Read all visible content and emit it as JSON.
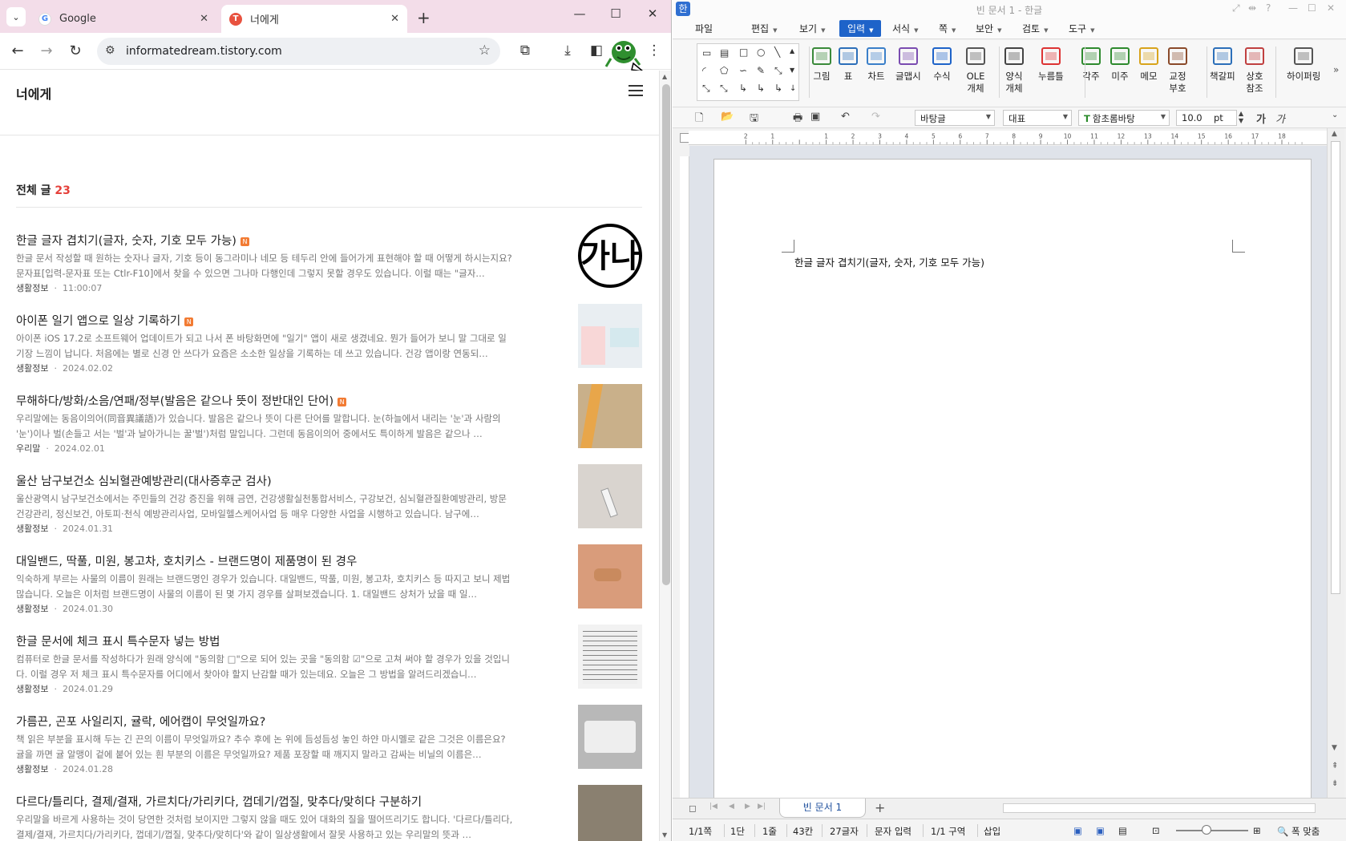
{
  "browser": {
    "tabs": [
      {
        "label": "Google",
        "favicon": "G"
      },
      {
        "label": "너에게",
        "favicon": "T"
      }
    ],
    "url": "informatedream.tistory.com"
  },
  "blog": {
    "title": "너에게",
    "all_posts_label": "전체 글",
    "all_posts_count": "23",
    "new_badge": "N",
    "posts": [
      {
        "title": "한글 글자 겹치기(글자, 숫자, 기호 모두 가능)",
        "desc": "한글 문서 작성할 때 원하는 숫자나 글자, 기호 등이 동그라미나 네모 등 테두리 안에 들어가게 표현해야 할 때 어떻게 하시는지요? 문자표[입력-문자표 또는 Ctlr-F10]에서 찾을 수 있으면 그나마 다행인데 그렇지 못할 경우도 있습니다. 이럴 때는 \"글자…",
        "category": "생활정보",
        "date": "11:00:07",
        "is_new": true,
        "thumb_text": "가나"
      },
      {
        "title": "아이폰 일기 앱으로 일상 기록하기",
        "desc": "아이폰 iOS 17.2로 소프트웨어 업데이트가 되고 나서 폰 바탕화면에 \"일기\" 앱이 새로 생겼네요. 뭔가 들어가 보니 말 그대로 일기장 느낌이 납니다. 처음에는 별로 신경 안 쓰다가 요즘은 소소한 일상을 기록하는 데 쓰고 있습니다. 건강 앱이랑 연동되…",
        "category": "생활정보",
        "date": "2024.02.02",
        "is_new": true,
        "thumb_text": ""
      },
      {
        "title": "무해하다/방화/소음/연패/정부(발음은 같으나 뜻이 정반대인 단어)",
        "desc": "우리말에는 동음이의어(同音異議語)가 있습니다. 발음은 같으나 뜻이 다른 단어를 말합니다. 눈(하늘에서 내리는 '눈'과 사람의 '눈')이나 벌(손들고 서는 '벌'과 날아가니는 꿀'벌')처럼 말입니다. 그런데 동음이의어 중에서도 특이하게 발음은 같으나 …",
        "category": "우리말",
        "date": "2024.02.01",
        "is_new": true,
        "thumb_text": ""
      },
      {
        "title": "울산 남구보건소 심뇌혈관예방관리(대사증후군 검사)",
        "desc": "울산광역시 남구보건소에서는 주민들의 건강 증진을 위해 금연, 건강생활실천통합서비스, 구강보건, 심뇌혈관질환예방관리, 방문건강관리, 정신보건, 아토피·천식 예방관리사업, 모바일헬스케어사업 등 매우 다양한 사업을 시행하고 있습니다. 남구에…",
        "category": "생활정보",
        "date": "2024.01.31",
        "is_new": false,
        "thumb_text": ""
      },
      {
        "title": "대일밴드, 딱풀, 미원, 봉고차, 호치키스 - 브랜드명이 제품명이 된 경우",
        "desc": "익숙하게 부르는 사물의 이름이 원래는 브랜드명인 경우가 있습니다. 대일밴드, 딱풀, 미원, 봉고차, 호치키스 등 따지고 보니 제법 많습니다. 오늘은 이처럼 브랜드명이 사물의 이름이 된 몇 가지 경우를 살펴보겠습니다. 1. 대일밴드 상처가 났을 때 일…",
        "category": "생활정보",
        "date": "2024.01.30",
        "is_new": false,
        "thumb_text": ""
      },
      {
        "title": "한글 문서에 체크 표시 특수문자 넣는 방법",
        "desc": "컴퓨터로 한글 문서를 작성하다가 원래 양식에 \"동의함 □\"으로 되어 있는 곳을 \"동의함 ☑\"으로 고쳐 써야 할 경우가 있을 것입니다. 이럴 경우 저 체크 표시 특수문자를 어디에서 찾아야 할지 난감할 때가 있는데요. 오늘은 그 방법을 알려드리겠습니…",
        "category": "생활정보",
        "date": "2024.01.29",
        "is_new": false,
        "thumb_text": ""
      },
      {
        "title": "가름끈, 곤포 사일리지, 귤락, 에어캡이 무엇일까요?",
        "desc": "책 읽은 부분을 표시해 두는 긴 끈의 이름이 무엇일까요? 추수 후에 논 위에 듬성듬성 놓인 하얀 마시멜로 같은 그것은 이름은요? 귤을 까면 귤 알맹이 겉에 붙어 있는 흰 부분의 이름은 무엇일까요? 제품 포장할 때 깨지지 말라고 감싸는 비닐의 이름은…",
        "category": "생활정보",
        "date": "2024.01.28",
        "is_new": false,
        "thumb_text": ""
      },
      {
        "title": "다르다/틀리다, 결제/결재, 가르치다/가리키다, 껍데기/껍질, 맞추다/맞히다 구분하기",
        "desc": "우리말을 바르게 사용하는 것이 당연한 것처럼 보이지만 그렇지 않을 때도 있어 대화의 질을 떨어뜨리기도 합니다. '다르다/틀리다, 결제/결재, 가르치다/가리키다, 껍데기/껍질, 맞추다/맞히다'와 같이 일상생활에서 잘못 사용하고 있는 우리말의 뜻과 …",
        "category": "우리말",
        "date": "",
        "is_new": false,
        "thumb_text": ""
      }
    ]
  },
  "hwp": {
    "app_logo": "한",
    "window_title": "빈 문서 1 - 한글",
    "menus": [
      "파일",
      "편집",
      "보기",
      "입력",
      "서식",
      "쪽",
      "보안",
      "검토",
      "도구"
    ],
    "active_menu": "입력",
    "ribbon": [
      {
        "label": "그림",
        "icon": "picture-icon"
      },
      {
        "label": "표",
        "icon": "table-icon"
      },
      {
        "label": "차트",
        "icon": "chart-icon"
      },
      {
        "label": "글맵시",
        "icon": "wordart-icon"
      },
      {
        "label": "수식",
        "icon": "equation-icon"
      },
      {
        "label": "OLE\n개체",
        "icon": "ole-icon"
      },
      {
        "label": "양식\n개체",
        "icon": "form-icon"
      },
      {
        "label": "누름틀",
        "icon": "field-icon"
      },
      {
        "label": "각주",
        "icon": "footnote-icon"
      },
      {
        "label": "미주",
        "icon": "endnote-icon"
      },
      {
        "label": "메모",
        "icon": "memo-icon"
      },
      {
        "label": "교정\n부호",
        "icon": "proofread-icon"
      },
      {
        "label": "책갈피",
        "icon": "bookmark-icon"
      },
      {
        "label": "상호\n참조",
        "icon": "crossref-icon"
      },
      {
        "label": "하이퍼링",
        "icon": "hyperlink-icon"
      }
    ],
    "format": {
      "style": "바탕글",
      "lang": "대표",
      "font": "함초롬바탕",
      "size": "10.0",
      "unit": "pt",
      "font_icon": "T",
      "char_glyph_1": "가",
      "char_glyph_2": "가"
    },
    "ruler_h": [
      "2",
      "1",
      "",
      "1",
      "2",
      "3",
      "4",
      "5",
      "6",
      "7",
      "8",
      "9",
      "10",
      "11",
      "12",
      "13",
      "14",
      "15",
      "16",
      "17",
      "18"
    ],
    "document_text": "한글 글자 겹치기(글자, 숫자, 기호 모두 가능)",
    "doc_tab": "빈 문서 1",
    "status": {
      "page": "1/1쪽",
      "column": "1단",
      "line": "1줄",
      "col_pos": "43칸",
      "chars": "27글자",
      "mode": "문자 입력",
      "section": "1/1 구역",
      "insert": "삽입",
      "fit": "폭 맞춤"
    }
  }
}
